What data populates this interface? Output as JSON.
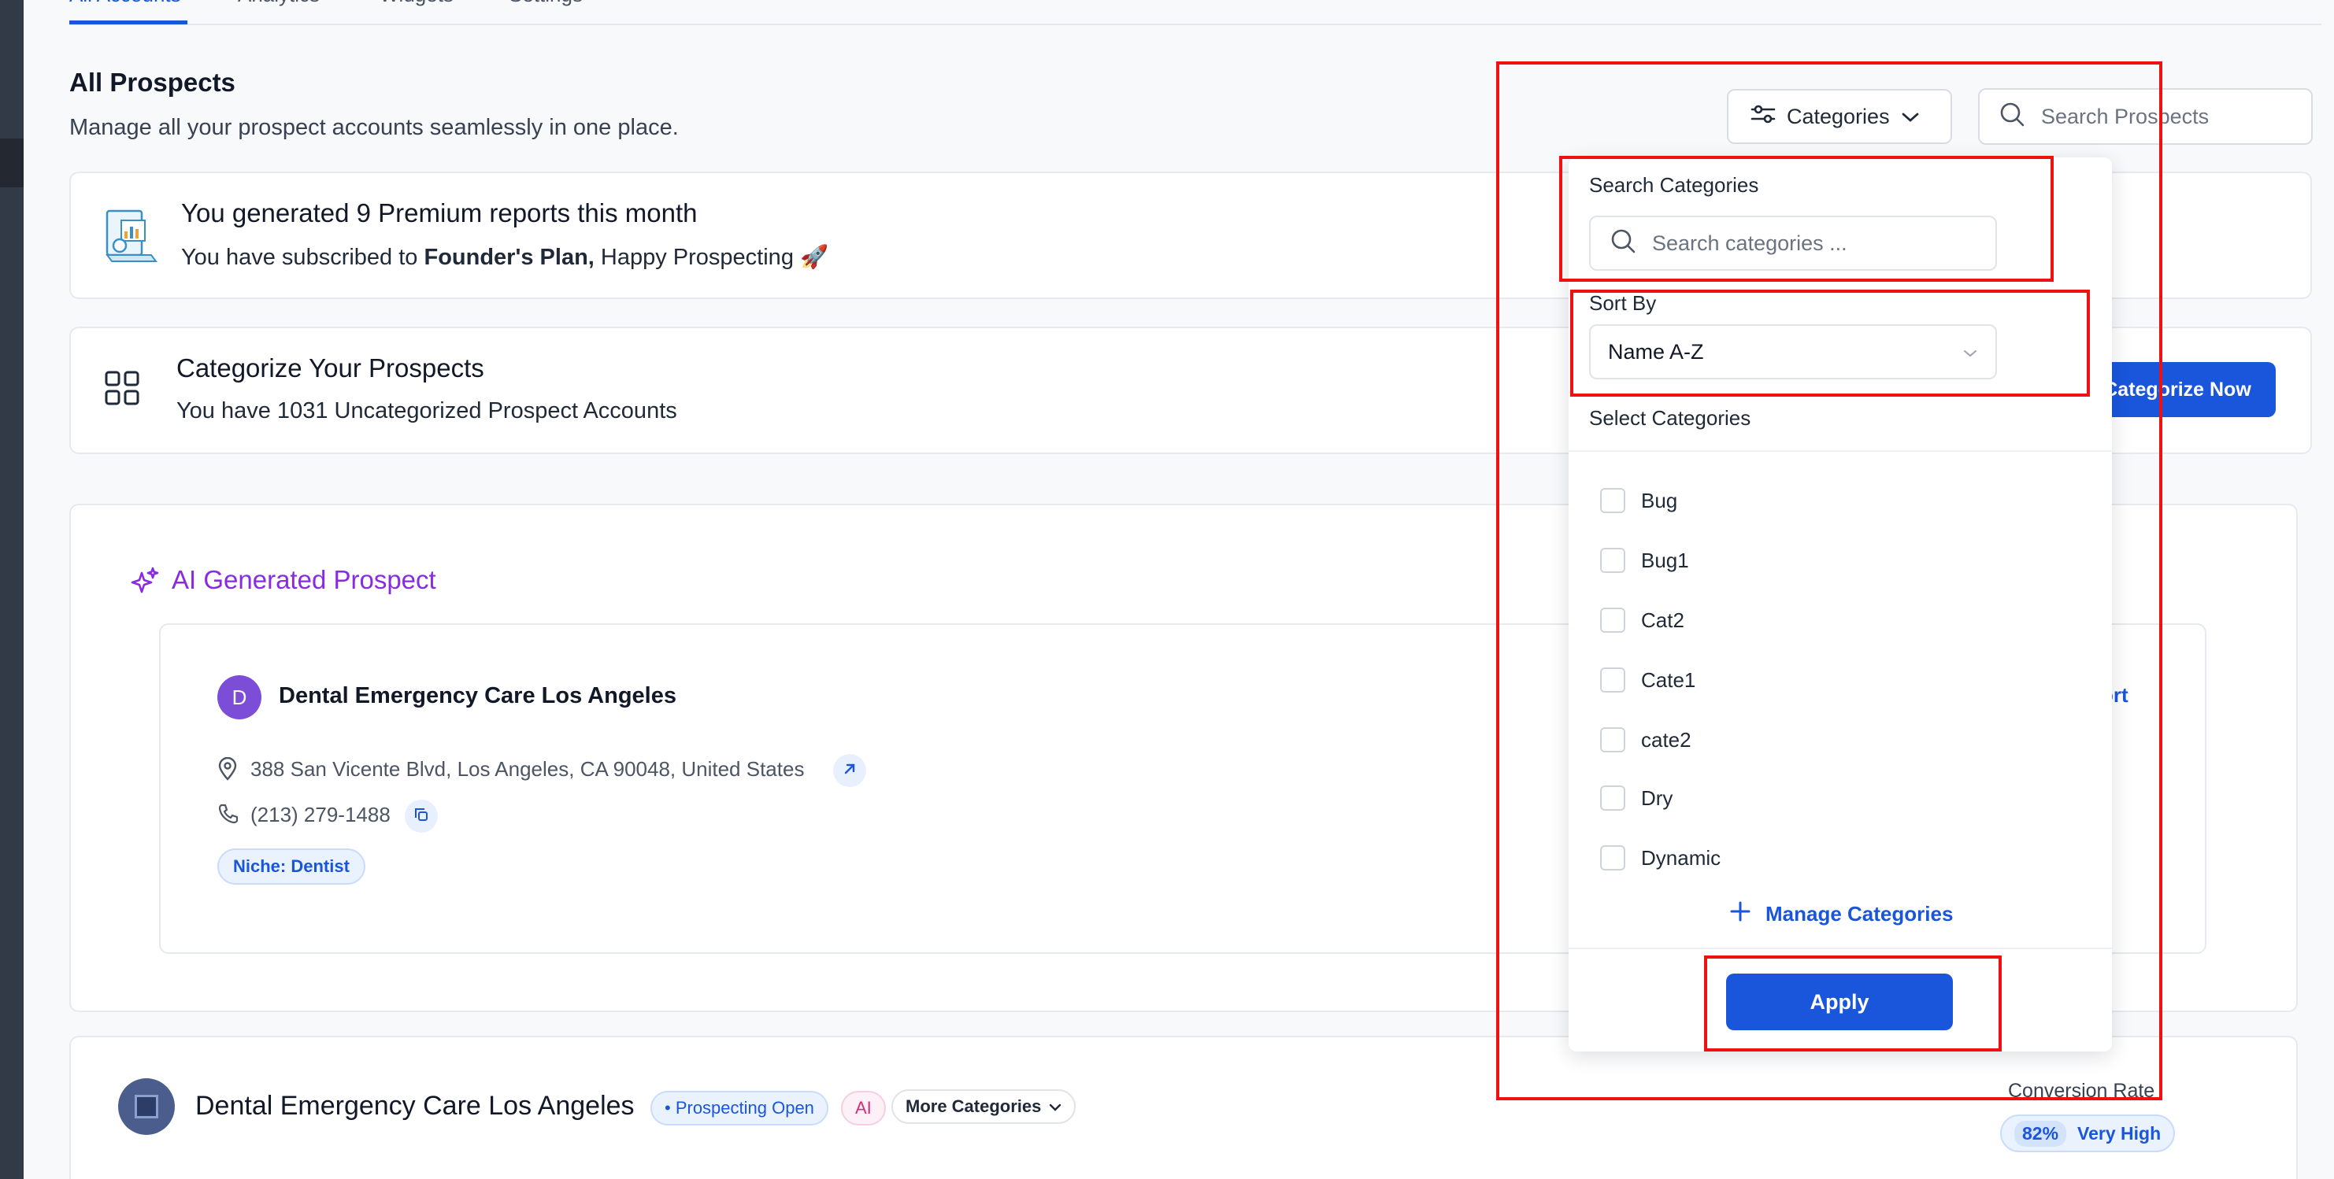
{
  "tabs": [
    "All Accounts",
    "Analytics",
    "Widgets",
    "Settings"
  ],
  "page": {
    "title": "All Prospects",
    "subtitle": "Manage all your prospect accounts seamlessly in one place."
  },
  "header": {
    "categories_label": "Categories",
    "search_placeholder": "Search Prospects"
  },
  "premium": {
    "title": "You generated 9 Premium reports this month",
    "line_prefix": "You have subscribed to ",
    "plan": "Founder's Plan,",
    "line_suffix": " Happy Prospecting 🚀"
  },
  "categorize": {
    "title": "Categorize Your Prospects",
    "subtitle": "You have 1031 Uncategorized Prospect Accounts",
    "button": "Categorize Now"
  },
  "ai_section": {
    "title": "AI Generated Prospect",
    "avatar_letter": "D",
    "business_name": "Dental Emergency Care Los Angeles",
    "address": "388 San Vicente Blvd, Los Angeles, CA 90048, United States",
    "phone": "(213) 279-1488",
    "niche": "Niche: Dentist",
    "report_link": "ort"
  },
  "bottom_row": {
    "business_name": "Dental Emergency Care Los Angeles",
    "status": "• Prospecting Open",
    "ai_badge": "AI",
    "more_categories": "More Categories",
    "conversion_label": "Conversion Rate",
    "conversion_pct": "82%",
    "conversion_level": "Very High"
  },
  "dropdown": {
    "search_label": "Search Categories",
    "search_placeholder": "Search categories ...",
    "sort_label": "Sort By",
    "sort_value": "Name A-Z",
    "select_label": "Select Categories",
    "categories": [
      "Bug",
      "Bug1",
      "Cat2",
      "Cate1",
      "cate2",
      "Dry",
      "Dynamic"
    ],
    "manage_label": "Manage Categories",
    "apply_label": "Apply"
  },
  "colors": {
    "accent": "#1a56db",
    "ai_purple": "#8a2be2",
    "annotation_red": "#ee1111"
  }
}
